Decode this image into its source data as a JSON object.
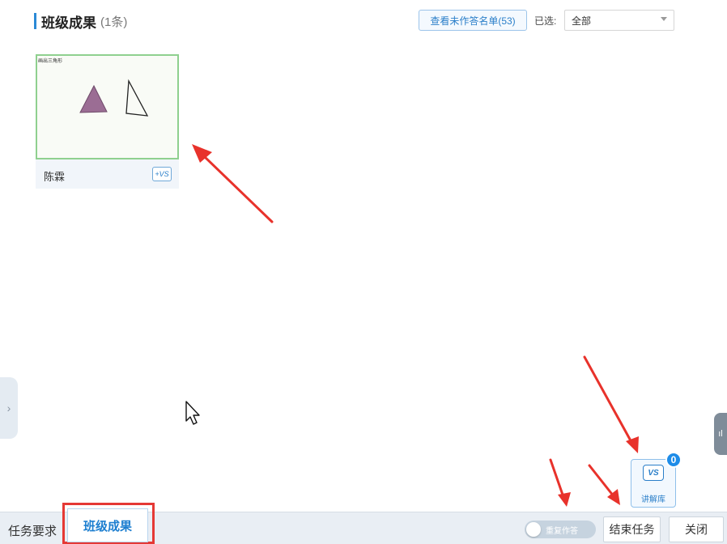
{
  "header": {
    "title": "班级成果",
    "count": "(1条)",
    "unsubmitted_button": "查看未作答名单(53)",
    "selected_label": "已选:",
    "filter_value": "全部"
  },
  "card": {
    "student_name": "陈霖",
    "thumb_caption": "画出三角形",
    "vs_label": "+VS"
  },
  "side": {
    "left_tab_glyph": "›",
    "right_tab_glyph": "ıl"
  },
  "explain_library": {
    "icon_label": "VS",
    "label": "讲解库",
    "badge": "0"
  },
  "bottom_bar": {
    "tab_requirements": "任务要求",
    "tab_results": "班级成果",
    "toggle_label": "重复作答",
    "end_task": "结束任务",
    "close": "关闭"
  },
  "colors": {
    "accent": "#2b89d6",
    "highlight": "#e53935",
    "triangle_fill": "#9b6d94"
  }
}
